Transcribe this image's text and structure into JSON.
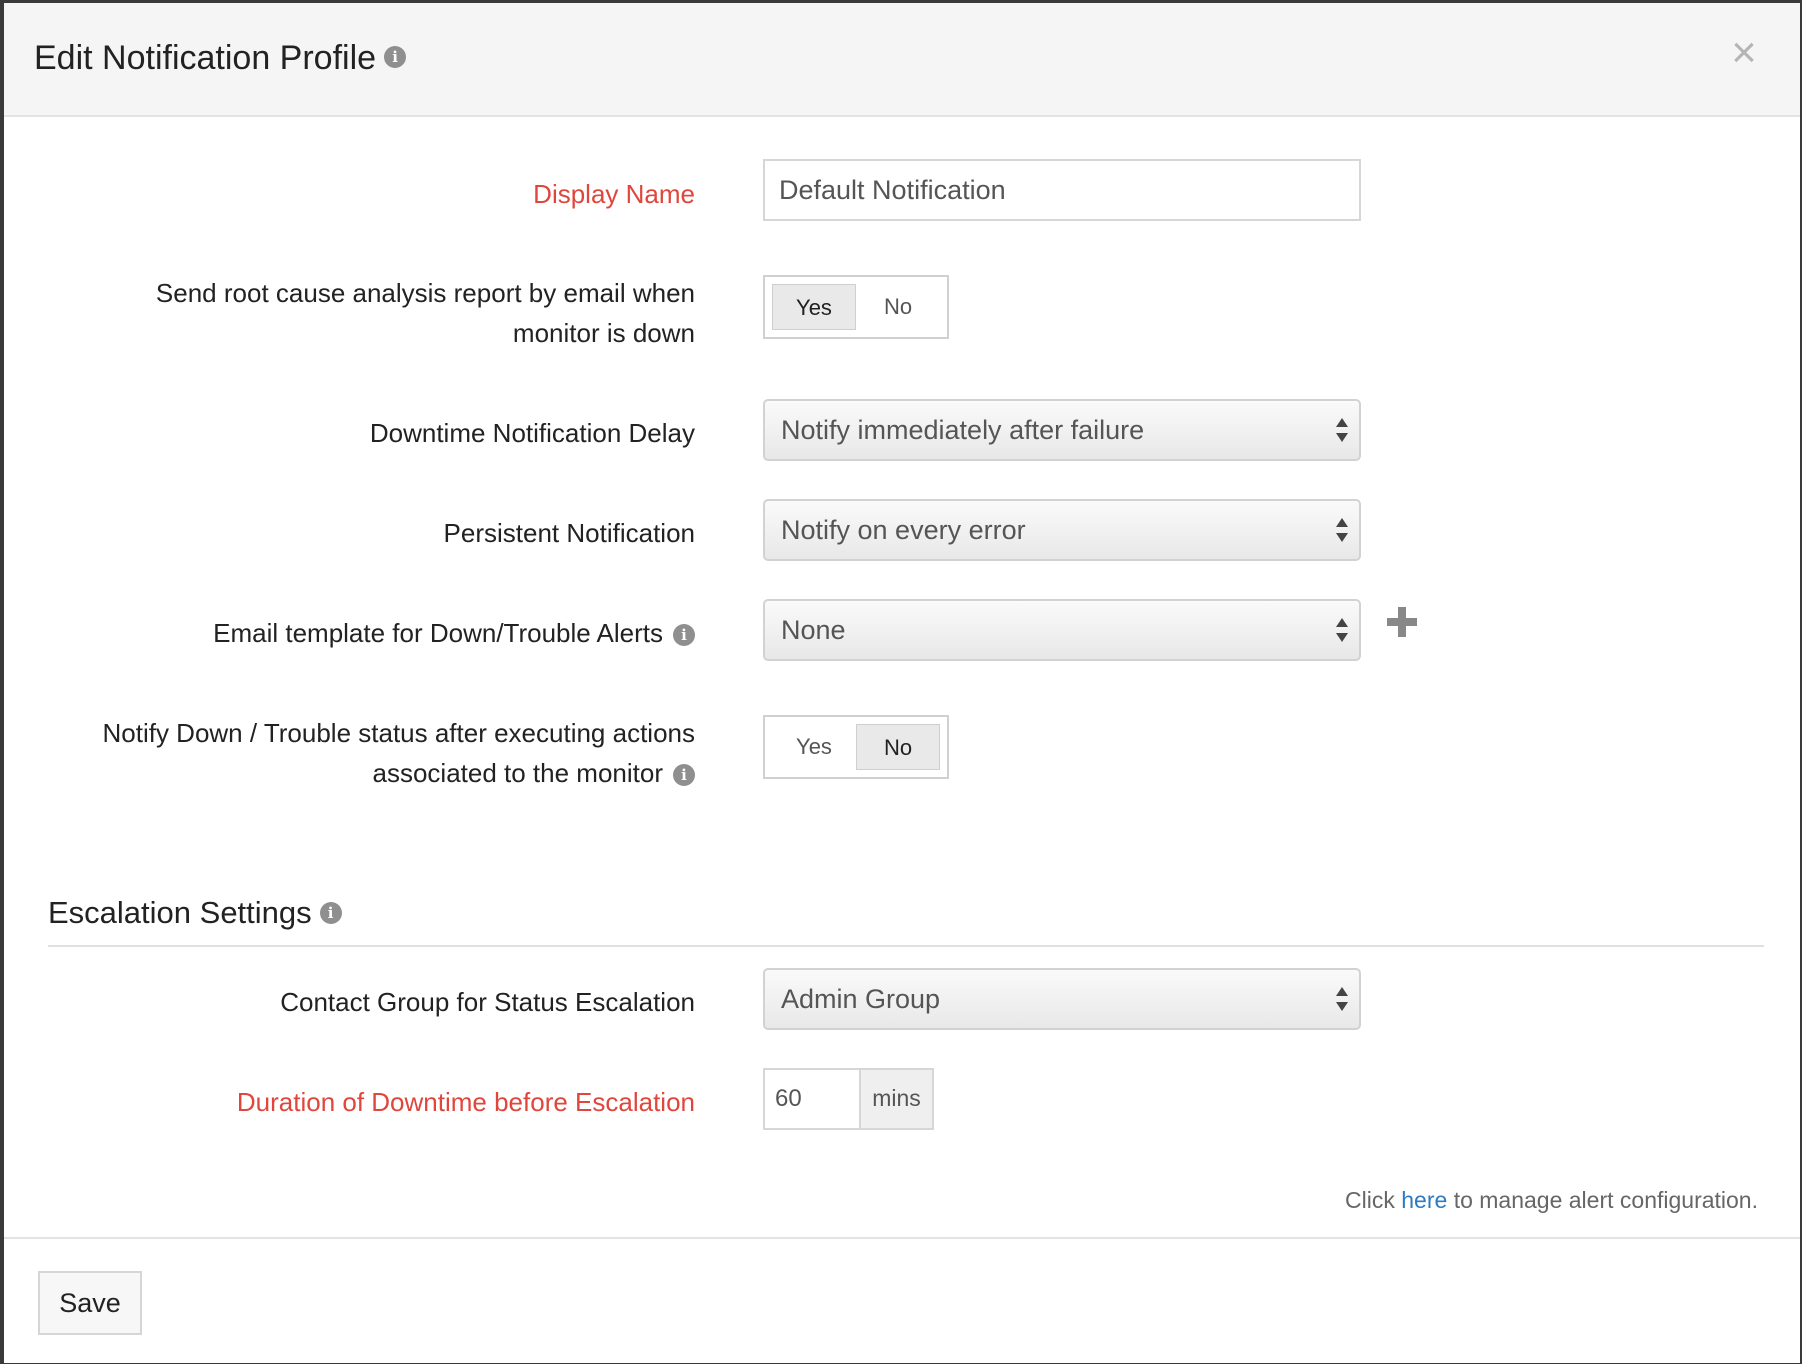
{
  "dialog": {
    "title": "Edit Notification Profile",
    "close_symbol": "×"
  },
  "form": {
    "display_name": {
      "label": "Display Name",
      "value": "Default Notification"
    },
    "rca_report": {
      "label_line1": "Send root cause analysis report by email when",
      "label_line2": "monitor is down",
      "yes": "Yes",
      "no": "No",
      "selected": "Yes"
    },
    "downtime_delay": {
      "label": "Downtime Notification Delay",
      "value": "Notify immediately after failure"
    },
    "persistent": {
      "label": "Persistent Notification",
      "value": "Notify on every error"
    },
    "email_template": {
      "label": "Email template for Down/Trouble Alerts",
      "value": "None"
    },
    "notify_after_actions": {
      "label_line1": "Notify Down / Trouble status after executing actions",
      "label_line2": "associated to the monitor",
      "yes": "Yes",
      "no": "No",
      "selected": "No"
    }
  },
  "escalation": {
    "section_title": "Escalation Settings",
    "contact_group": {
      "label": "Contact Group for Status Escalation",
      "value": "Admin Group"
    },
    "duration": {
      "label": "Duration of Downtime before Escalation",
      "value": "60",
      "unit": "mins"
    }
  },
  "footnote": {
    "prefix": "Click",
    "link": "here",
    "suffix": "to manage alert configuration."
  },
  "footer": {
    "save_label": "Save"
  },
  "icons": {
    "info": "i",
    "plus": "plus-icon",
    "select_arrows": "updown-arrows-icon"
  },
  "colors": {
    "required_label": "#e0463c",
    "link": "#2e7bc4",
    "header_bg": "#f5f5f5"
  }
}
